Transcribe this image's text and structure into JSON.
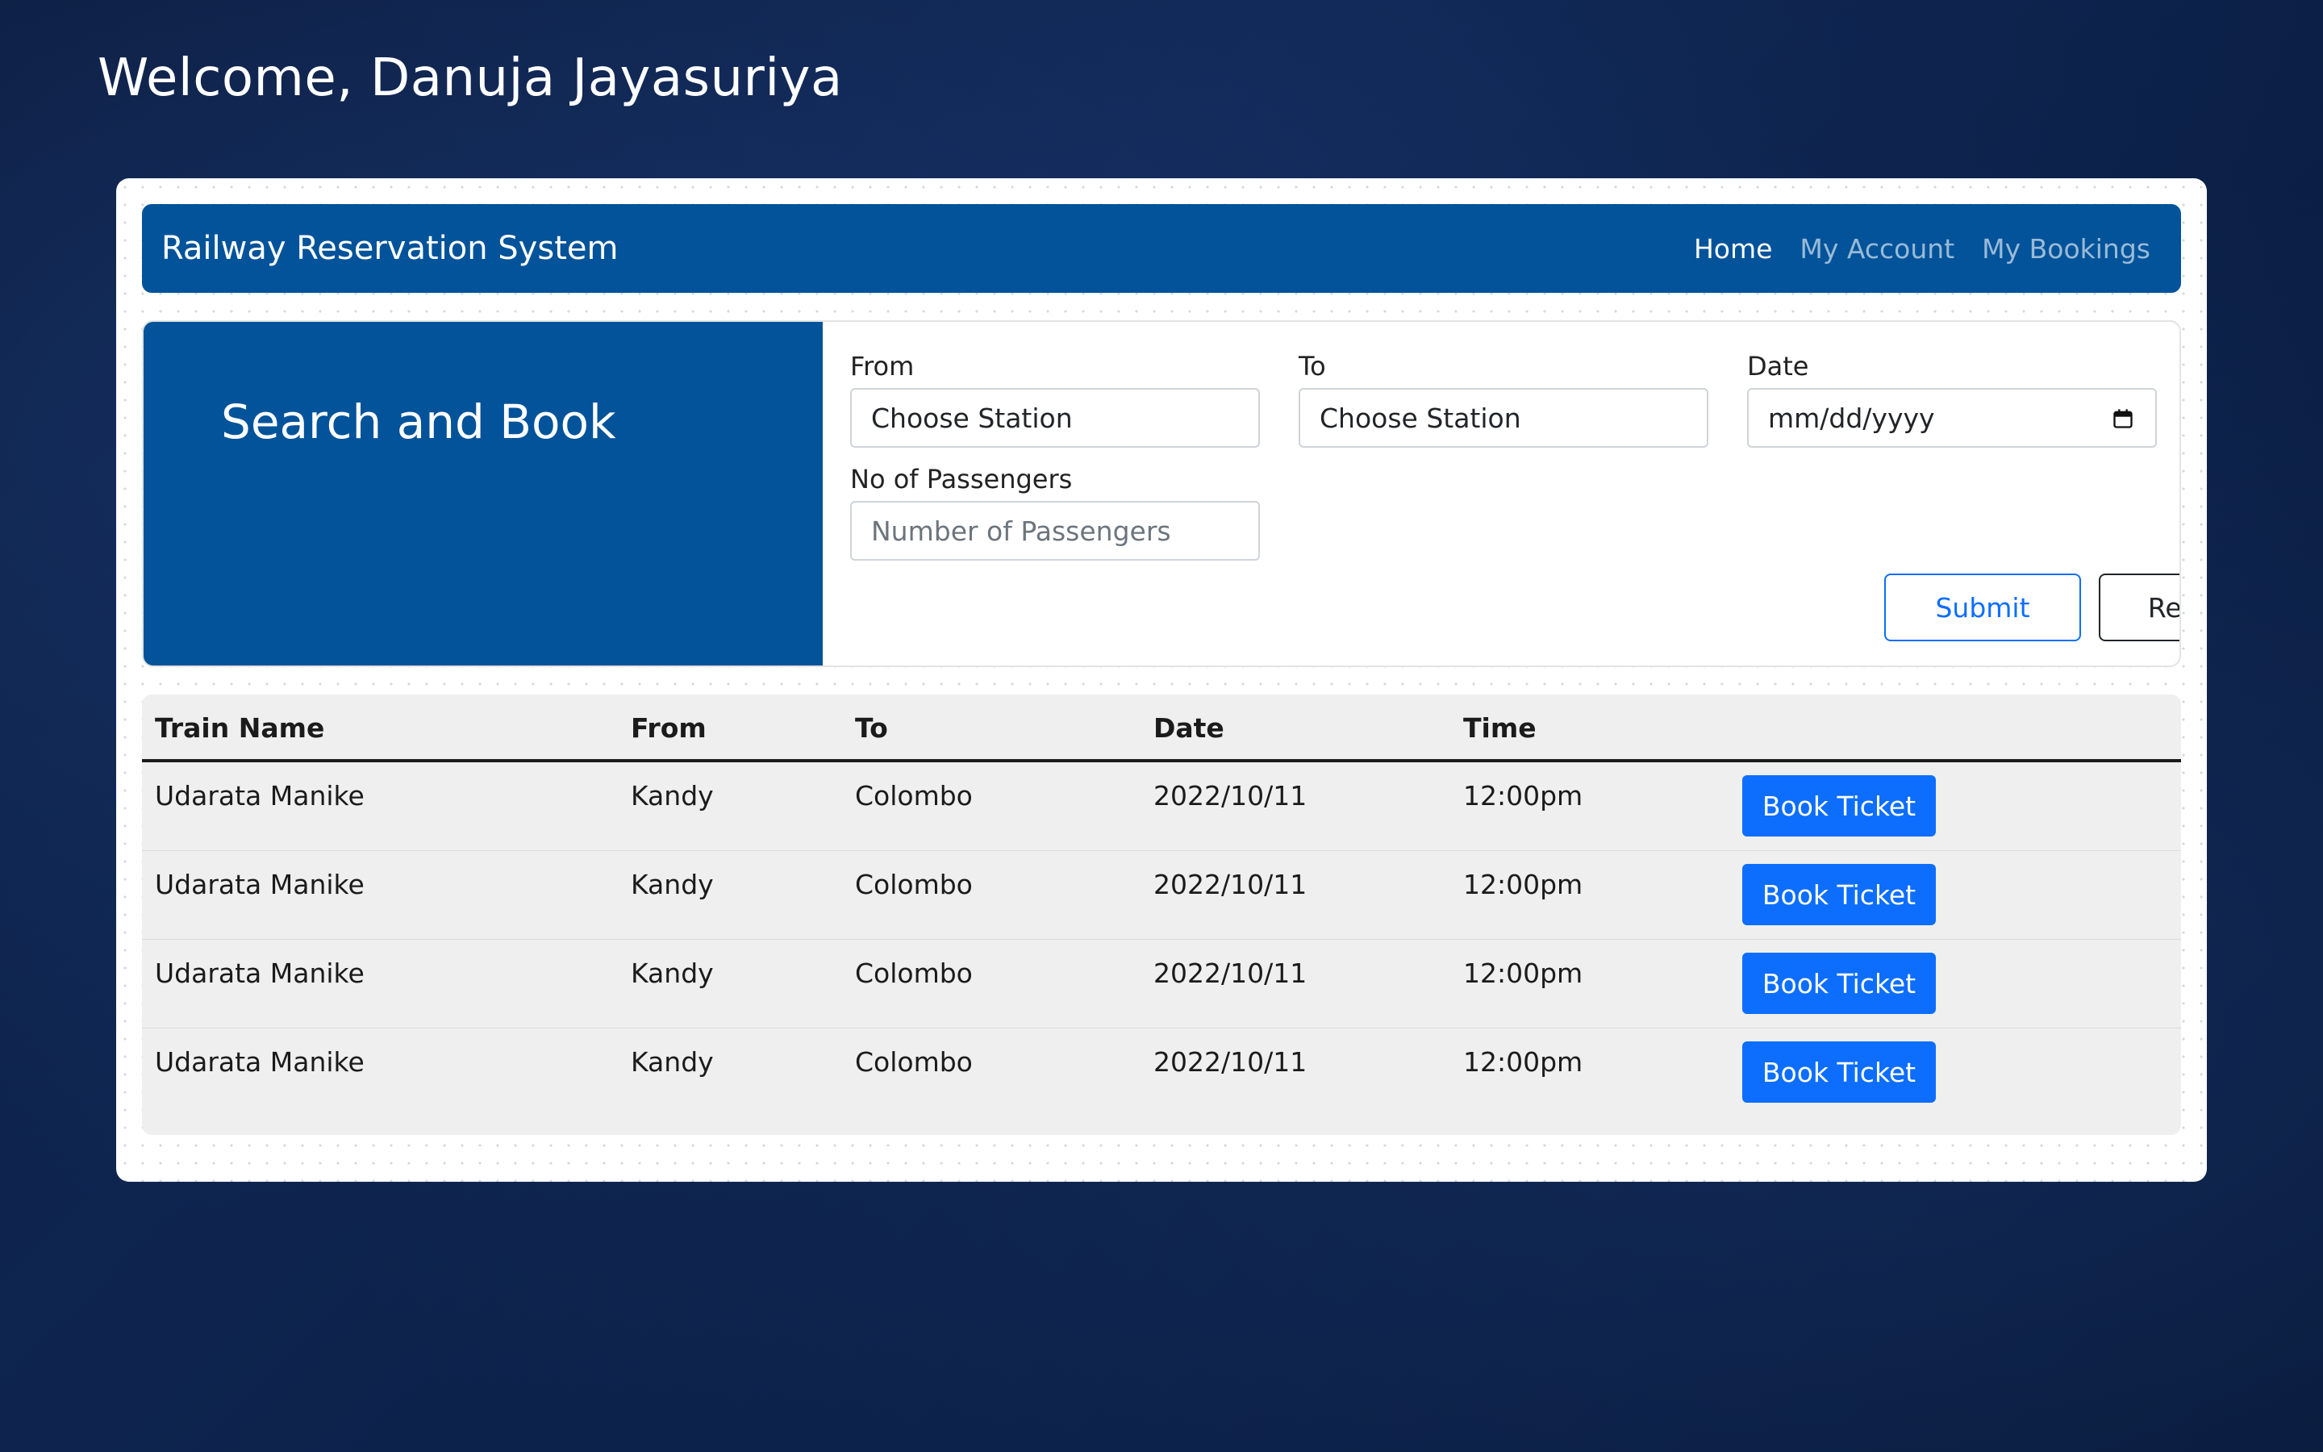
{
  "welcome": "Welcome, Danuja Jayasuriya",
  "navbar": {
    "brand": "Railway Reservation System",
    "links": [
      {
        "label": "Home",
        "active": true
      },
      {
        "label": "My Account",
        "active": false
      },
      {
        "label": "My Bookings",
        "active": false
      }
    ]
  },
  "search": {
    "title": "Search and Book",
    "from": {
      "label": "From",
      "value": "Choose Station"
    },
    "to": {
      "label": "To",
      "value": "Choose Station"
    },
    "date": {
      "label": "Date",
      "value": "mm/dd/yyyy",
      "icon": "calendar-icon"
    },
    "passengers": {
      "label": "No of Passengers",
      "placeholder": "Number of Passengers"
    },
    "submit_label": "Submit",
    "reset_label": "Reset"
  },
  "table": {
    "headers": [
      "Train Name",
      "From",
      "To",
      "Date",
      "Time"
    ],
    "rows": [
      {
        "train": "Udarata Manike",
        "from": "Kandy",
        "to": "Colombo",
        "date": "2022/10/11",
        "time": "12:00pm",
        "action": "Book Ticket"
      },
      {
        "train": "Udarata Manike",
        "from": "Kandy",
        "to": "Colombo",
        "date": "2022/10/11",
        "time": "12:00pm",
        "action": "Book Ticket"
      },
      {
        "train": "Udarata Manike",
        "from": "Kandy",
        "to": "Colombo",
        "date": "2022/10/11",
        "time": "12:00pm",
        "action": "Book Ticket"
      },
      {
        "train": "Udarata Manike",
        "from": "Kandy",
        "to": "Colombo",
        "date": "2022/10/11",
        "time": "12:00pm",
        "action": "Book Ticket"
      }
    ]
  },
  "colors": {
    "primary": "#02539a",
    "button_blue": "#0d6efd",
    "table_bg": "#efefef"
  }
}
